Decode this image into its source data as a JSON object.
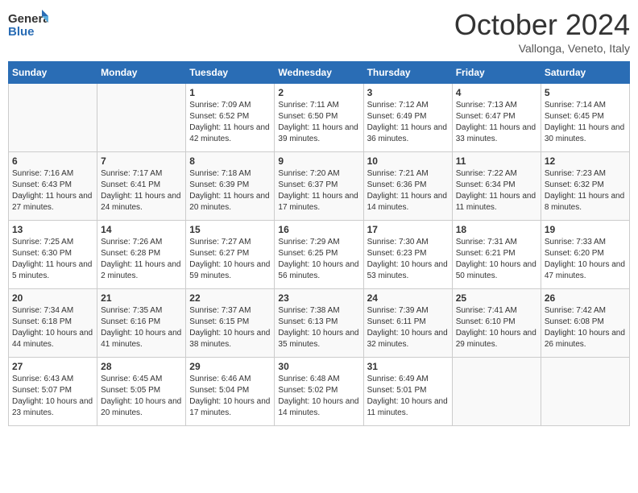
{
  "header": {
    "logo_general": "General",
    "logo_blue": "Blue",
    "month": "October 2024",
    "location": "Vallonga, Veneto, Italy"
  },
  "days_of_week": [
    "Sunday",
    "Monday",
    "Tuesday",
    "Wednesday",
    "Thursday",
    "Friday",
    "Saturday"
  ],
  "weeks": [
    [
      {
        "day": "",
        "content": ""
      },
      {
        "day": "",
        "content": ""
      },
      {
        "day": "1",
        "content": "Sunrise: 7:09 AM\nSunset: 6:52 PM\nDaylight: 11 hours and 42 minutes."
      },
      {
        "day": "2",
        "content": "Sunrise: 7:11 AM\nSunset: 6:50 PM\nDaylight: 11 hours and 39 minutes."
      },
      {
        "day": "3",
        "content": "Sunrise: 7:12 AM\nSunset: 6:49 PM\nDaylight: 11 hours and 36 minutes."
      },
      {
        "day": "4",
        "content": "Sunrise: 7:13 AM\nSunset: 6:47 PM\nDaylight: 11 hours and 33 minutes."
      },
      {
        "day": "5",
        "content": "Sunrise: 7:14 AM\nSunset: 6:45 PM\nDaylight: 11 hours and 30 minutes."
      }
    ],
    [
      {
        "day": "6",
        "content": "Sunrise: 7:16 AM\nSunset: 6:43 PM\nDaylight: 11 hours and 27 minutes."
      },
      {
        "day": "7",
        "content": "Sunrise: 7:17 AM\nSunset: 6:41 PM\nDaylight: 11 hours and 24 minutes."
      },
      {
        "day": "8",
        "content": "Sunrise: 7:18 AM\nSunset: 6:39 PM\nDaylight: 11 hours and 20 minutes."
      },
      {
        "day": "9",
        "content": "Sunrise: 7:20 AM\nSunset: 6:37 PM\nDaylight: 11 hours and 17 minutes."
      },
      {
        "day": "10",
        "content": "Sunrise: 7:21 AM\nSunset: 6:36 PM\nDaylight: 11 hours and 14 minutes."
      },
      {
        "day": "11",
        "content": "Sunrise: 7:22 AM\nSunset: 6:34 PM\nDaylight: 11 hours and 11 minutes."
      },
      {
        "day": "12",
        "content": "Sunrise: 7:23 AM\nSunset: 6:32 PM\nDaylight: 11 hours and 8 minutes."
      }
    ],
    [
      {
        "day": "13",
        "content": "Sunrise: 7:25 AM\nSunset: 6:30 PM\nDaylight: 11 hours and 5 minutes."
      },
      {
        "day": "14",
        "content": "Sunrise: 7:26 AM\nSunset: 6:28 PM\nDaylight: 11 hours and 2 minutes."
      },
      {
        "day": "15",
        "content": "Sunrise: 7:27 AM\nSunset: 6:27 PM\nDaylight: 10 hours and 59 minutes."
      },
      {
        "day": "16",
        "content": "Sunrise: 7:29 AM\nSunset: 6:25 PM\nDaylight: 10 hours and 56 minutes."
      },
      {
        "day": "17",
        "content": "Sunrise: 7:30 AM\nSunset: 6:23 PM\nDaylight: 10 hours and 53 minutes."
      },
      {
        "day": "18",
        "content": "Sunrise: 7:31 AM\nSunset: 6:21 PM\nDaylight: 10 hours and 50 minutes."
      },
      {
        "day": "19",
        "content": "Sunrise: 7:33 AM\nSunset: 6:20 PM\nDaylight: 10 hours and 47 minutes."
      }
    ],
    [
      {
        "day": "20",
        "content": "Sunrise: 7:34 AM\nSunset: 6:18 PM\nDaylight: 10 hours and 44 minutes."
      },
      {
        "day": "21",
        "content": "Sunrise: 7:35 AM\nSunset: 6:16 PM\nDaylight: 10 hours and 41 minutes."
      },
      {
        "day": "22",
        "content": "Sunrise: 7:37 AM\nSunset: 6:15 PM\nDaylight: 10 hours and 38 minutes."
      },
      {
        "day": "23",
        "content": "Sunrise: 7:38 AM\nSunset: 6:13 PM\nDaylight: 10 hours and 35 minutes."
      },
      {
        "day": "24",
        "content": "Sunrise: 7:39 AM\nSunset: 6:11 PM\nDaylight: 10 hours and 32 minutes."
      },
      {
        "day": "25",
        "content": "Sunrise: 7:41 AM\nSunset: 6:10 PM\nDaylight: 10 hours and 29 minutes."
      },
      {
        "day": "26",
        "content": "Sunrise: 7:42 AM\nSunset: 6:08 PM\nDaylight: 10 hours and 26 minutes."
      }
    ],
    [
      {
        "day": "27",
        "content": "Sunrise: 6:43 AM\nSunset: 5:07 PM\nDaylight: 10 hours and 23 minutes."
      },
      {
        "day": "28",
        "content": "Sunrise: 6:45 AM\nSunset: 5:05 PM\nDaylight: 10 hours and 20 minutes."
      },
      {
        "day": "29",
        "content": "Sunrise: 6:46 AM\nSunset: 5:04 PM\nDaylight: 10 hours and 17 minutes."
      },
      {
        "day": "30",
        "content": "Sunrise: 6:48 AM\nSunset: 5:02 PM\nDaylight: 10 hours and 14 minutes."
      },
      {
        "day": "31",
        "content": "Sunrise: 6:49 AM\nSunset: 5:01 PM\nDaylight: 10 hours and 11 minutes."
      },
      {
        "day": "",
        "content": ""
      },
      {
        "day": "",
        "content": ""
      }
    ]
  ]
}
